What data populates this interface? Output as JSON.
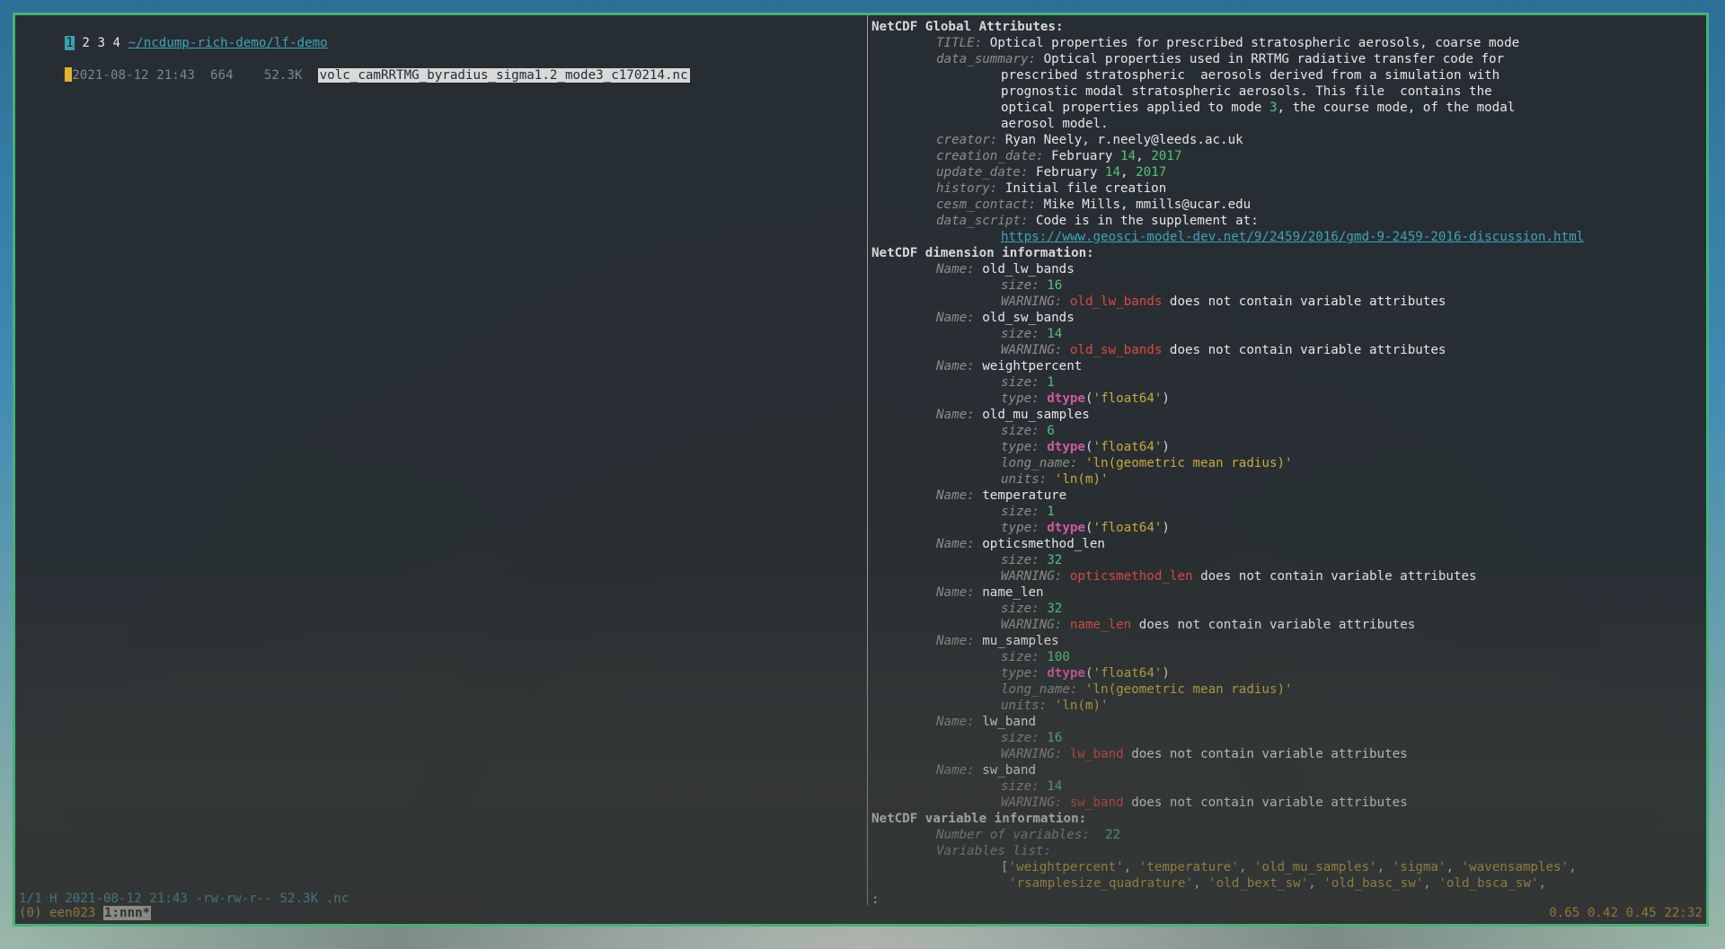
{
  "tabs": [
    {
      "label": "1",
      "active": true
    },
    {
      "label": "2",
      "active": false
    },
    {
      "label": "3",
      "active": false
    },
    {
      "label": "4",
      "active": false
    }
  ],
  "path": "~/ncdump-rich-demo/lf-demo",
  "file_entry": {
    "date": "2021-08-12 21:43",
    "count": "664",
    "size": "52.3K",
    "name": "volc_camRRTMG_byradius_sigma1.2_mode3_c170214.nc"
  },
  "status_line": "1/1 H 2021-08-12 21:43 -rw-rw-r-- 52.3K .nc",
  "prompt": ":",
  "tmux": {
    "session": "(0) een023",
    "window": "1:nnn*",
    "load": "0.65 0.42 0.45",
    "time": "22:32"
  },
  "global": {
    "header": "NetCDF Global Attributes:",
    "title_key": "TITLE:",
    "title": "Optical properties for prescribed stratospheric aerosols, coarse mode",
    "summary_key": "data_summary:",
    "summary": [
      "Optical properties used in RRTMG radiative transfer code for",
      "prescribed stratospheric  aerosols derived from a simulation with",
      "prognostic modal stratospheric aerosols. This file  contains the",
      "optical properties applied to mode ",
      "aerosol model."
    ],
    "summary_mode_num": "3",
    "summary_tail": ", the course mode, of the modal",
    "creator_key": "creator:",
    "creator": "Ryan Neely, r.neely@leeds.ac.uk",
    "creation_key": "creation_date:",
    "creation_month": "February ",
    "creation_day": "14",
    "creation_year": "2017",
    "update_key": "update_date:",
    "update_month": "February ",
    "update_day": "14",
    "update_year": "2017",
    "history_key": "history:",
    "history": "Initial file creation",
    "contact_key": "cesm_contact:",
    "contact": "Mike Mills, mmills@ucar.edu",
    "script_key": "data_script:",
    "script": "Code is in the supplement at:",
    "script_url": "https://www.geosci-model-dev.net/9/2459/2016/gmd-9-2459-2016-discussion.html"
  },
  "dims": {
    "header": "NetCDF dimension information:",
    "name_key": "Name:",
    "size_key": "size:",
    "type_key": "type:",
    "warn_key": "WARNING:",
    "long_key": "long_name:",
    "units_key": "units:",
    "warn_text": " does not contain variable attributes",
    "dtype_fn": "dtype",
    "items": [
      {
        "name": "old_lw_bands",
        "size": "16"
      },
      {
        "name": "old_sw_bands",
        "size": "14"
      },
      {
        "name": "weightpercent",
        "size": "1",
        "dtype": "'float64'"
      },
      {
        "name": "old_mu_samples",
        "size": "6",
        "dtype": "'float64'",
        "long_name": "'ln(geometric mean radius)'",
        "units": "'ln(m)'"
      },
      {
        "name": "temperature",
        "size": "1",
        "dtype": "'float64'"
      },
      {
        "name": "opticsmethod_len",
        "size": "32"
      },
      {
        "name": "name_len",
        "size": "32"
      },
      {
        "name": "mu_samples",
        "size": "100",
        "dtype": "'float64'",
        "long_name": "'ln(geometric mean radius)'",
        "units": "'ln(m)'"
      },
      {
        "name": "lw_band",
        "size": "16"
      },
      {
        "name": "sw_band",
        "size": "14"
      }
    ]
  },
  "vars": {
    "header": "NetCDF variable information:",
    "count_key": "Number of variables:",
    "count": "22",
    "list_key": "Variables list:",
    "list": [
      "'weightpercent'",
      "'temperature'",
      "'old_mu_samples'",
      "'sigma'",
      "'wavensamples'",
      "'rsamplesize_quadrature'",
      "'old_bext_sw'",
      "'old_basc_sw'",
      "'old_bsca_sw'"
    ]
  }
}
